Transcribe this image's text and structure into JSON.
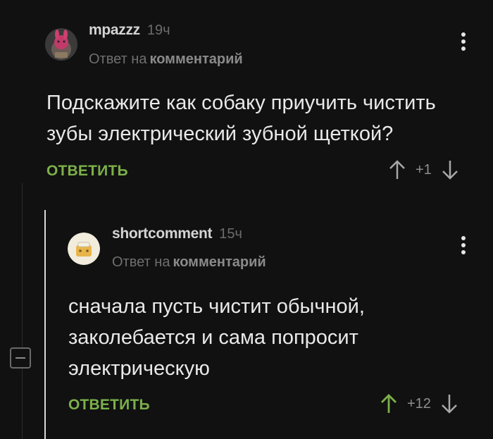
{
  "comments": [
    {
      "author": "mpazzz",
      "time": "19ч",
      "reply_prefix": "Ответ на",
      "reply_target": "комментарий",
      "text_line1": "Подскажите как собаку приучить чистить",
      "text_line2": "зубы электрический зубной щеткой?",
      "reply_label": "ОТВЕТИТЬ",
      "score": "+1",
      "upvoted": false
    },
    {
      "author": "shortcomment",
      "time": "15ч",
      "reply_prefix": "Ответ на",
      "reply_target": "комментарий",
      "text_line1": "сначала пусть чистит обычной,",
      "text_line2": "заколебается и сама попросит",
      "text_line3": "электрическую",
      "reply_label": "ОТВЕТИТЬ",
      "score": "+12",
      "upvoted": true
    }
  ],
  "colors": {
    "background": "#111111",
    "accent_green": "#7cb04a",
    "text": "#e9e9e9",
    "muted": "#6f6f6f"
  },
  "icons": {
    "menu": "more-vertical-icon",
    "upvote": "arrow-up-icon",
    "downvote": "arrow-down-icon",
    "collapse": "minus-icon"
  }
}
